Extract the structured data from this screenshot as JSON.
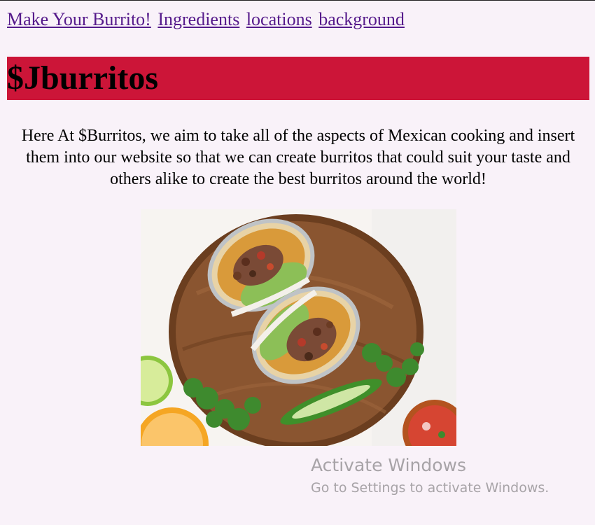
{
  "nav": {
    "links": [
      "Make Your Burrito!",
      "Ingredients",
      "locations",
      "background"
    ]
  },
  "header": {
    "title": "$Jburritos",
    "banner_color": "#cc1538"
  },
  "intro": {
    "text": "Here At $Burritos, we aim to take all of the aspects of Mexican cooking and insert them into our website so that we can create burritos that could suit your taste and others alike to create the best burritos around the world!"
  },
  "hero_image": {
    "subject": "burrito-halves-on-wooden-board"
  },
  "watermark": {
    "title": "Activate Windows",
    "subtitle": "Go to Settings to activate Windows."
  }
}
